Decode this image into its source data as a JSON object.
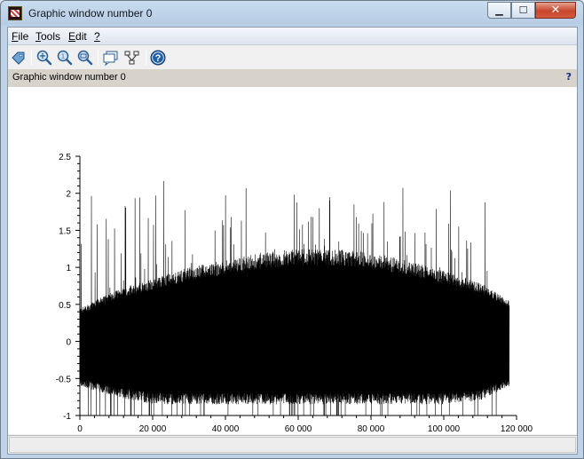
{
  "window": {
    "title": "Graphic window number 0",
    "minimize_glyph": "▁",
    "maximize_glyph": "☐",
    "close_glyph": "✕"
  },
  "menu": [
    {
      "key": "F",
      "rest": "ile"
    },
    {
      "key": "T",
      "rest": "ools"
    },
    {
      "key": "E",
      "rest": "dit"
    },
    {
      "key": "?",
      "rest": ""
    }
  ],
  "toolbar": {
    "icons": [
      "rotate-icon",
      "zoom-in-icon",
      "zoom-out-icon",
      "zoom-reset-icon",
      "datatip-icon",
      "editor-icon",
      "help-icon"
    ]
  },
  "infobar": {
    "text": "Graphic window number 0",
    "help_glyph": "?"
  },
  "colors": {
    "plot": "#000000",
    "axis": "#000000",
    "help_icon": "#1f5fa8"
  },
  "chart_data": {
    "type": "line",
    "title": "",
    "xlabel": "",
    "ylabel": "",
    "xlim": [
      0,
      120000
    ],
    "ylim": [
      -1,
      2.5
    ],
    "x_ticks": [
      0,
      20000,
      40000,
      60000,
      80000,
      100000,
      120000
    ],
    "x_tick_labels": [
      "0",
      "20 000",
      "40 000",
      "60 000",
      "80 000",
      "100 000",
      "120 000"
    ],
    "y_ticks": [
      -1,
      -0.5,
      0,
      0.5,
      1,
      1.5,
      2,
      2.5
    ],
    "y_tick_labels": [
      "-1",
      "-0.5",
      "0",
      "0.5",
      "1",
      "1.5",
      "2",
      "2.5"
    ],
    "series": [
      {
        "description_x": [
          0,
          10000,
          20000,
          30000,
          40000,
          50000,
          60000,
          70000,
          80000,
          90000,
          100000,
          110000,
          118000
        ],
        "upper_envelope": [
          0.45,
          0.7,
          0.85,
          1.0,
          1.1,
          1.2,
          1.25,
          1.25,
          1.2,
          1.1,
          0.95,
          0.8,
          0.55
        ],
        "lower_envelope": [
          -0.6,
          -0.75,
          -0.85,
          -0.85,
          -0.85,
          -0.85,
          -0.85,
          -0.85,
          -0.85,
          -0.85,
          -0.85,
          -0.8,
          -0.6
        ],
        "max_peak": 2.3,
        "min_value": -1.0
      }
    ],
    "grid": false
  }
}
